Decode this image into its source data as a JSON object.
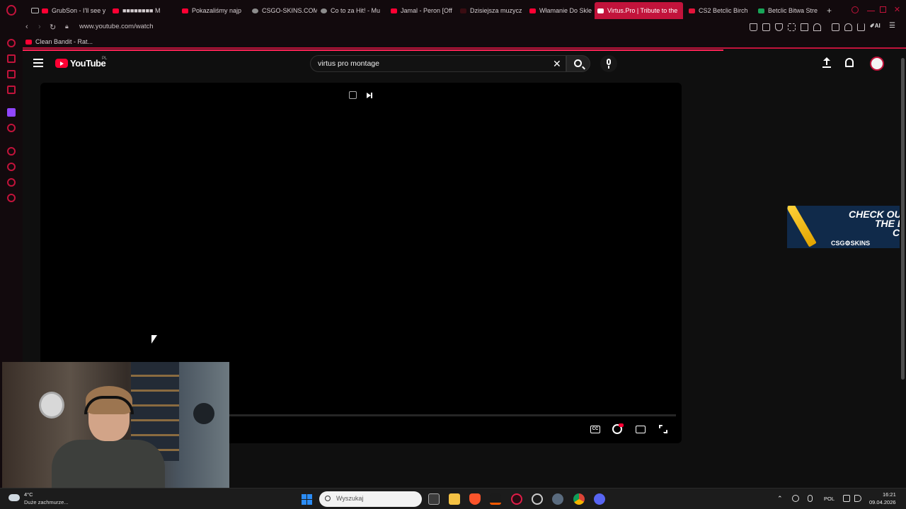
{
  "browser": {
    "tabs": [
      {
        "label": "GrubSon - I'll see y",
        "favicon": "youtube-icon"
      },
      {
        "label": "■■■■■■■■ M",
        "favicon": "youtube-icon"
      },
      {
        "label": "Pokazaliśmy najp",
        "favicon": "youtube-icon"
      },
      {
        "label": "CSGO-SKINS.COM",
        "favicon": "site-icon"
      },
      {
        "label": "Co to za Hit! - Mu",
        "favicon": "music-icon"
      },
      {
        "label": "Jamal - Peron [Off",
        "favicon": "youtube-icon"
      },
      {
        "label": "Dzisiejsza muzycz",
        "favicon": "youtube-icon"
      },
      {
        "label": "Włamanie Do Skle",
        "favicon": "youtube-icon"
      },
      {
        "label": "Virtus.Pro | Tribute to the",
        "favicon": "youtube-icon",
        "active": true
      },
      {
        "label": "CS2 Betclic Birch",
        "favicon": "betclic-icon"
      },
      {
        "label": "Betclic Bitwa Stre",
        "favicon": "sheets-icon"
      }
    ],
    "url": "www.youtube.com/watch",
    "bookmark": "Clean Bandit - Rat...",
    "accent_color": "#c2133b"
  },
  "youtube": {
    "logo_text": "YouTube",
    "region": "PL",
    "search_query": "virtus pro montage"
  },
  "ad": {
    "line1": "CHECK OU",
    "line2": "THE BE",
    "line3": "CAS",
    "brand": "CSG⚙SKINS"
  },
  "taskbar": {
    "weather_temp": "4°C",
    "weather_desc": "Duże zachmurze...",
    "search_placeholder": "Wyszukaj",
    "language": "POL",
    "time": "16:21",
    "date": "09.04.2026"
  }
}
